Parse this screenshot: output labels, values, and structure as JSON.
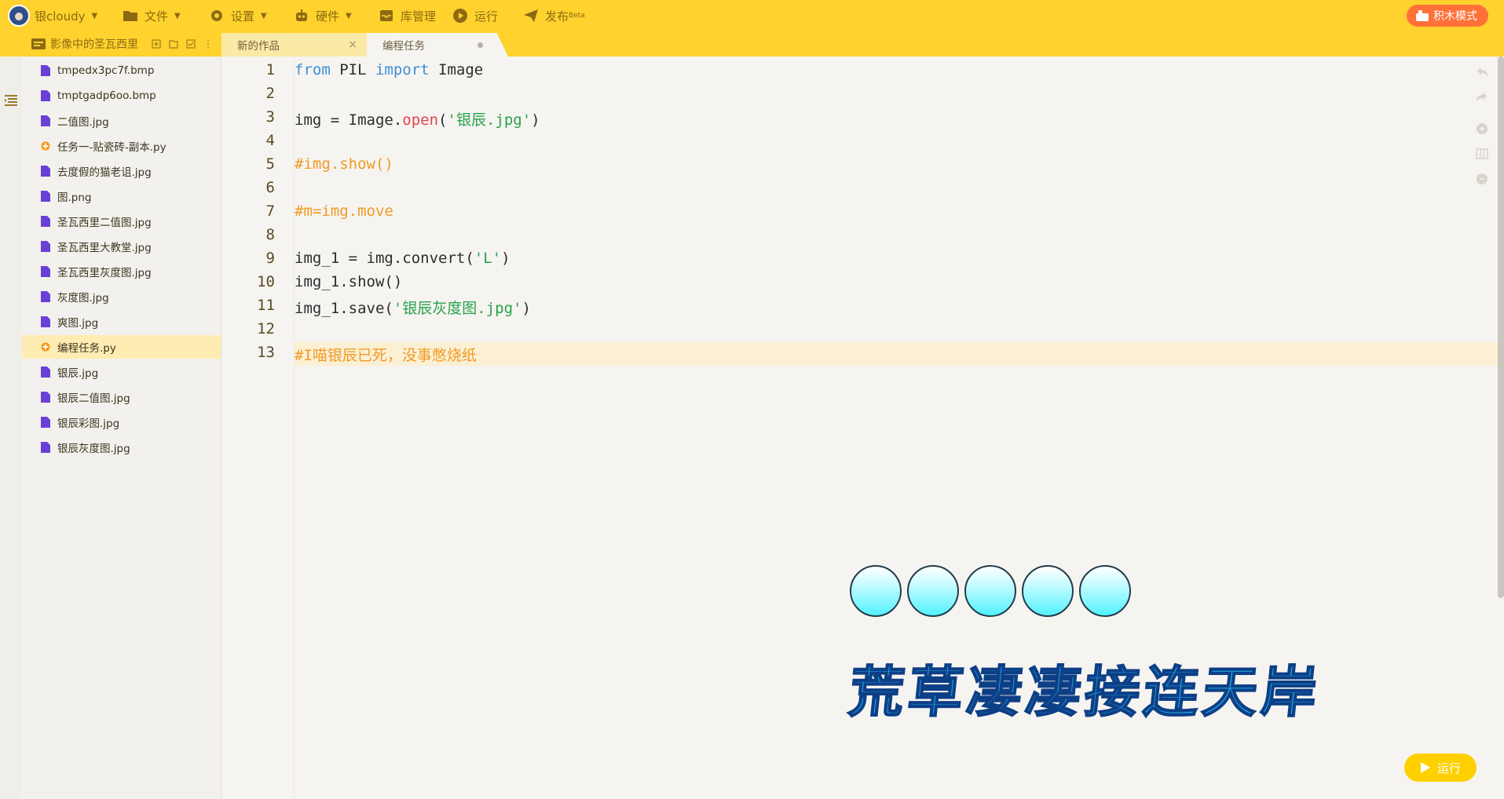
{
  "menu": {
    "user": "银cloudy",
    "file": "文件",
    "settings": "设置",
    "hardware": "硬件",
    "library": "库管理",
    "run": "运行",
    "publish": "发布",
    "publish_badge": "Beta",
    "mode": "积木模式"
  },
  "project": {
    "name": "影像中的圣瓦西里"
  },
  "files": [
    {
      "name": "tmpedx3pc7f.bmp",
      "type": "image"
    },
    {
      "name": "tmptgadp6oo.bmp",
      "type": "image"
    },
    {
      "name": "二值图.jpg",
      "type": "image"
    },
    {
      "name": "任务一-贴瓷砖-副本.py",
      "type": "python"
    },
    {
      "name": "去度假的猫老诅.jpg",
      "type": "image"
    },
    {
      "name": "图.png",
      "type": "image"
    },
    {
      "name": "圣瓦西里二值图.jpg",
      "type": "image"
    },
    {
      "name": "圣瓦西里大教堂.jpg",
      "type": "image"
    },
    {
      "name": "圣瓦西里灰度图.jpg",
      "type": "image"
    },
    {
      "name": "灰度图.jpg",
      "type": "image"
    },
    {
      "name": "爽图.jpg",
      "type": "image"
    },
    {
      "name": "编程任务.py",
      "type": "python",
      "active": true
    },
    {
      "name": "银辰.jpg",
      "type": "image"
    },
    {
      "name": "银辰二值图.jpg",
      "type": "image"
    },
    {
      "name": "银辰彩图.jpg",
      "type": "image"
    },
    {
      "name": "银辰灰度图.jpg",
      "type": "image"
    }
  ],
  "tabs": [
    {
      "label": "新的作品",
      "close": "×"
    },
    {
      "label": "编程任务"
    }
  ],
  "code": {
    "line_numbers": [
      "1",
      "2",
      "3",
      "4",
      "5",
      "6",
      "7",
      "8",
      "9",
      "10",
      "11",
      "12",
      "13"
    ],
    "l1": {
      "a": "from",
      "b": " PIL ",
      "c": "import",
      "d": " Image"
    },
    "l3": {
      "a": "img = Image.",
      "b": "open",
      "c": "(",
      "d": "'银辰.jpg'",
      "e": ")"
    },
    "l5": "#img.show()",
    "l7": "#m=img.move",
    "l9": {
      "a": "img_1 = img.convert(",
      "b": "'L'",
      "c": ")"
    },
    "l10": "img_1.show()",
    "l11": {
      "a": "img_1.save(",
      "b": "'银辰灰度图.jpg'",
      "c": ")"
    },
    "l13": "#I喵银辰已死，没事憋烧纸"
  },
  "stage": {
    "text": "荒草凄凄接连天岸",
    "ball_count": 5
  },
  "run_button": "运行",
  "colors": {
    "topbar": "#ffd22e",
    "accent_orange": "#ff7138",
    "keyword": "#3b8ed8",
    "function": "#e0444a",
    "string": "#28a24a",
    "comment": "#f09a24"
  }
}
